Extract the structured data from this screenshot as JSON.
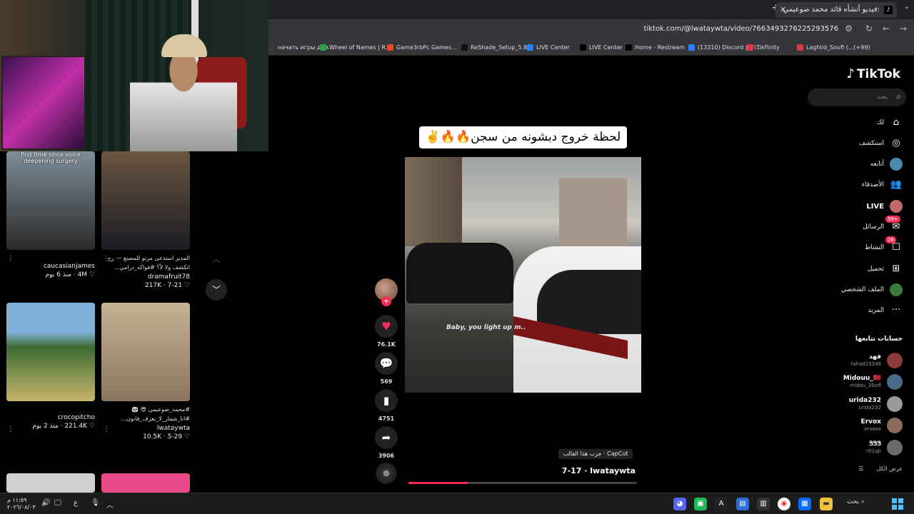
{
  "browser": {
    "tab_title": "فيديو أنشأه قائد محمد صوعيمي:",
    "new_tab": "+",
    "close": "✕",
    "url": "tiktok.com/@lwataywta/video/7663493276225293576",
    "bookmarks": [
      {
        "label": "начать игры для...",
        "color": "#3a3a3a"
      },
      {
        "label": "Wheel of Names | R...",
        "color": "#2ea043"
      },
      {
        "label": "Game3rbPc Games...",
        "color": "#e34c26"
      },
      {
        "label": "ReShade_Setup_5.8.0",
        "color": "#111111"
      },
      {
        "label": "LIVE Center",
        "color": "#2d7ff9"
      },
      {
        "label": "LIVE Center",
        "color": "#000000"
      },
      {
        "label": "Home - Restream",
        "color": "#000000"
      },
      {
        "label": "(13310) Discord | Fri...",
        "color": "#2d7ff9"
      },
      {
        "label": "TikFinity",
        "color": "#d73a49"
      },
      {
        "label": "Laghlid_Soufi (...(+99)",
        "color": "#d73a49"
      }
    ]
  },
  "feed": {
    "cards": [
      {
        "caption": "first time since voice deepening surgery",
        "author": "caucasianjames",
        "desc": "",
        "likes": "4M",
        "date": "منذ 6 يوم",
        "colors": [
          "#6a7a8a",
          "#2a2a2a"
        ]
      },
      {
        "caption": "",
        "author": "dramafruit78",
        "desc": "المدير استدعى مرتو للمصنع — رح انكشف ولا لأ؟ #فواكه_درامي...",
        "likes": "217K",
        "date": "7-21",
        "colors": [
          "#5a4a3a",
          "#1a1a22"
        ]
      },
      {
        "caption": "",
        "author": "crocopitcho",
        "desc": "",
        "likes": "221.4K",
        "date": "منذ 2 يوم",
        "colors": [
          "#6fa0c8",
          "#2f5a2a"
        ]
      },
      {
        "caption": "",
        "author": "lwataywta",
        "desc": "#محمد_صوعيمي 😎 🐼 #انا_شمار_لا_يعرف_قانون...",
        "likes": "10.5K",
        "date": "5-29",
        "colors": [
          "#b6a48a",
          "#7a6a58"
        ]
      }
    ]
  },
  "video": {
    "title": "لحظة خروج دبشونه من سجن🔥🔥✌️",
    "lyric": "Baby, you light up m..",
    "template": "CapCut · جرب هذا القالب",
    "author": "lwataywta",
    "date": "7-17",
    "progress": 0.26,
    "likes": "76.1K",
    "comments": "569",
    "saves": "4751",
    "shares": "3906"
  },
  "sidebar": {
    "logo": "TikTok",
    "search_placeholder": "بحث",
    "nav": [
      {
        "label": "لك",
        "icon": "⌂",
        "badge": ""
      },
      {
        "label": "استكشف",
        "icon": "◎",
        "badge": ""
      },
      {
        "label": "أتابعه",
        "icon": "●",
        "badge": ""
      },
      {
        "label": "الأصدقاء",
        "icon": "👥",
        "badge": ""
      },
      {
        "label": "LIVE",
        "icon": "●",
        "badge": ""
      },
      {
        "label": "الرسائل",
        "icon": "✉",
        "badge": "99+"
      },
      {
        "label": "النشاط",
        "icon": "☐",
        "badge": "26"
      },
      {
        "label": "تحميل",
        "icon": "⊞",
        "badge": ""
      },
      {
        "label": "الملف الشخصي",
        "icon": "♟",
        "badge": ""
      },
      {
        "label": "المزيد",
        "icon": "···",
        "badge": ""
      }
    ],
    "following_title": "حسابات تتابعها",
    "following": [
      {
        "name": "فهد",
        "id": "fahad23348",
        "color": "#8a3a3a"
      },
      {
        "name": "Midouu_🇲🇦",
        "id": "midou_35off",
        "color": "#4a6a8a"
      },
      {
        "name": "urida232",
        "id": "urida232",
        "color": "#9a9a9a"
      },
      {
        "name": "Ervox",
        "id": "ervoxx",
        "color": "#8a6a5a"
      },
      {
        "name": "ᏕᏕᏕ",
        "id": "rtl1qb",
        "color": "#6a6a6a"
      }
    ],
    "see_all": "عرض الكل"
  },
  "taskbar": {
    "time": "١١:٥٩ م",
    "date": "٢٠٢٦/٠٨/٠٣",
    "lang": "ع",
    "search": "بحث"
  }
}
